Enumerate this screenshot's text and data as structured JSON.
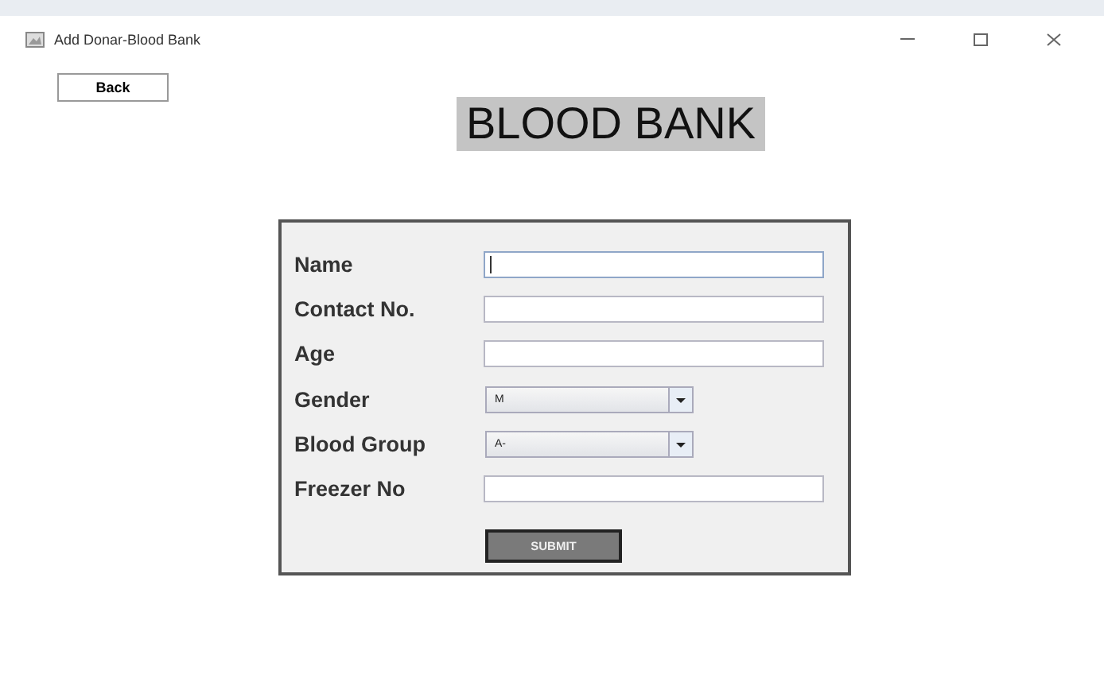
{
  "window": {
    "title": "Add Donar-Blood Bank"
  },
  "back_button": "Back",
  "heading": "BLOOD BANK",
  "form": {
    "fields": [
      {
        "kind": "text",
        "label": "Name",
        "focused": true
      },
      {
        "kind": "text",
        "label": "Contact No.",
        "focused": false
      },
      {
        "kind": "text",
        "label": "Age",
        "focused": false
      },
      {
        "kind": "combo",
        "label": "Gender",
        "value": "M",
        "focused": false
      },
      {
        "kind": "combo",
        "label": "Blood Group",
        "value": "A-",
        "focused": false
      },
      {
        "kind": "text",
        "label": "Freezer No",
        "focused": false
      }
    ],
    "submit": "SUBMIT"
  }
}
